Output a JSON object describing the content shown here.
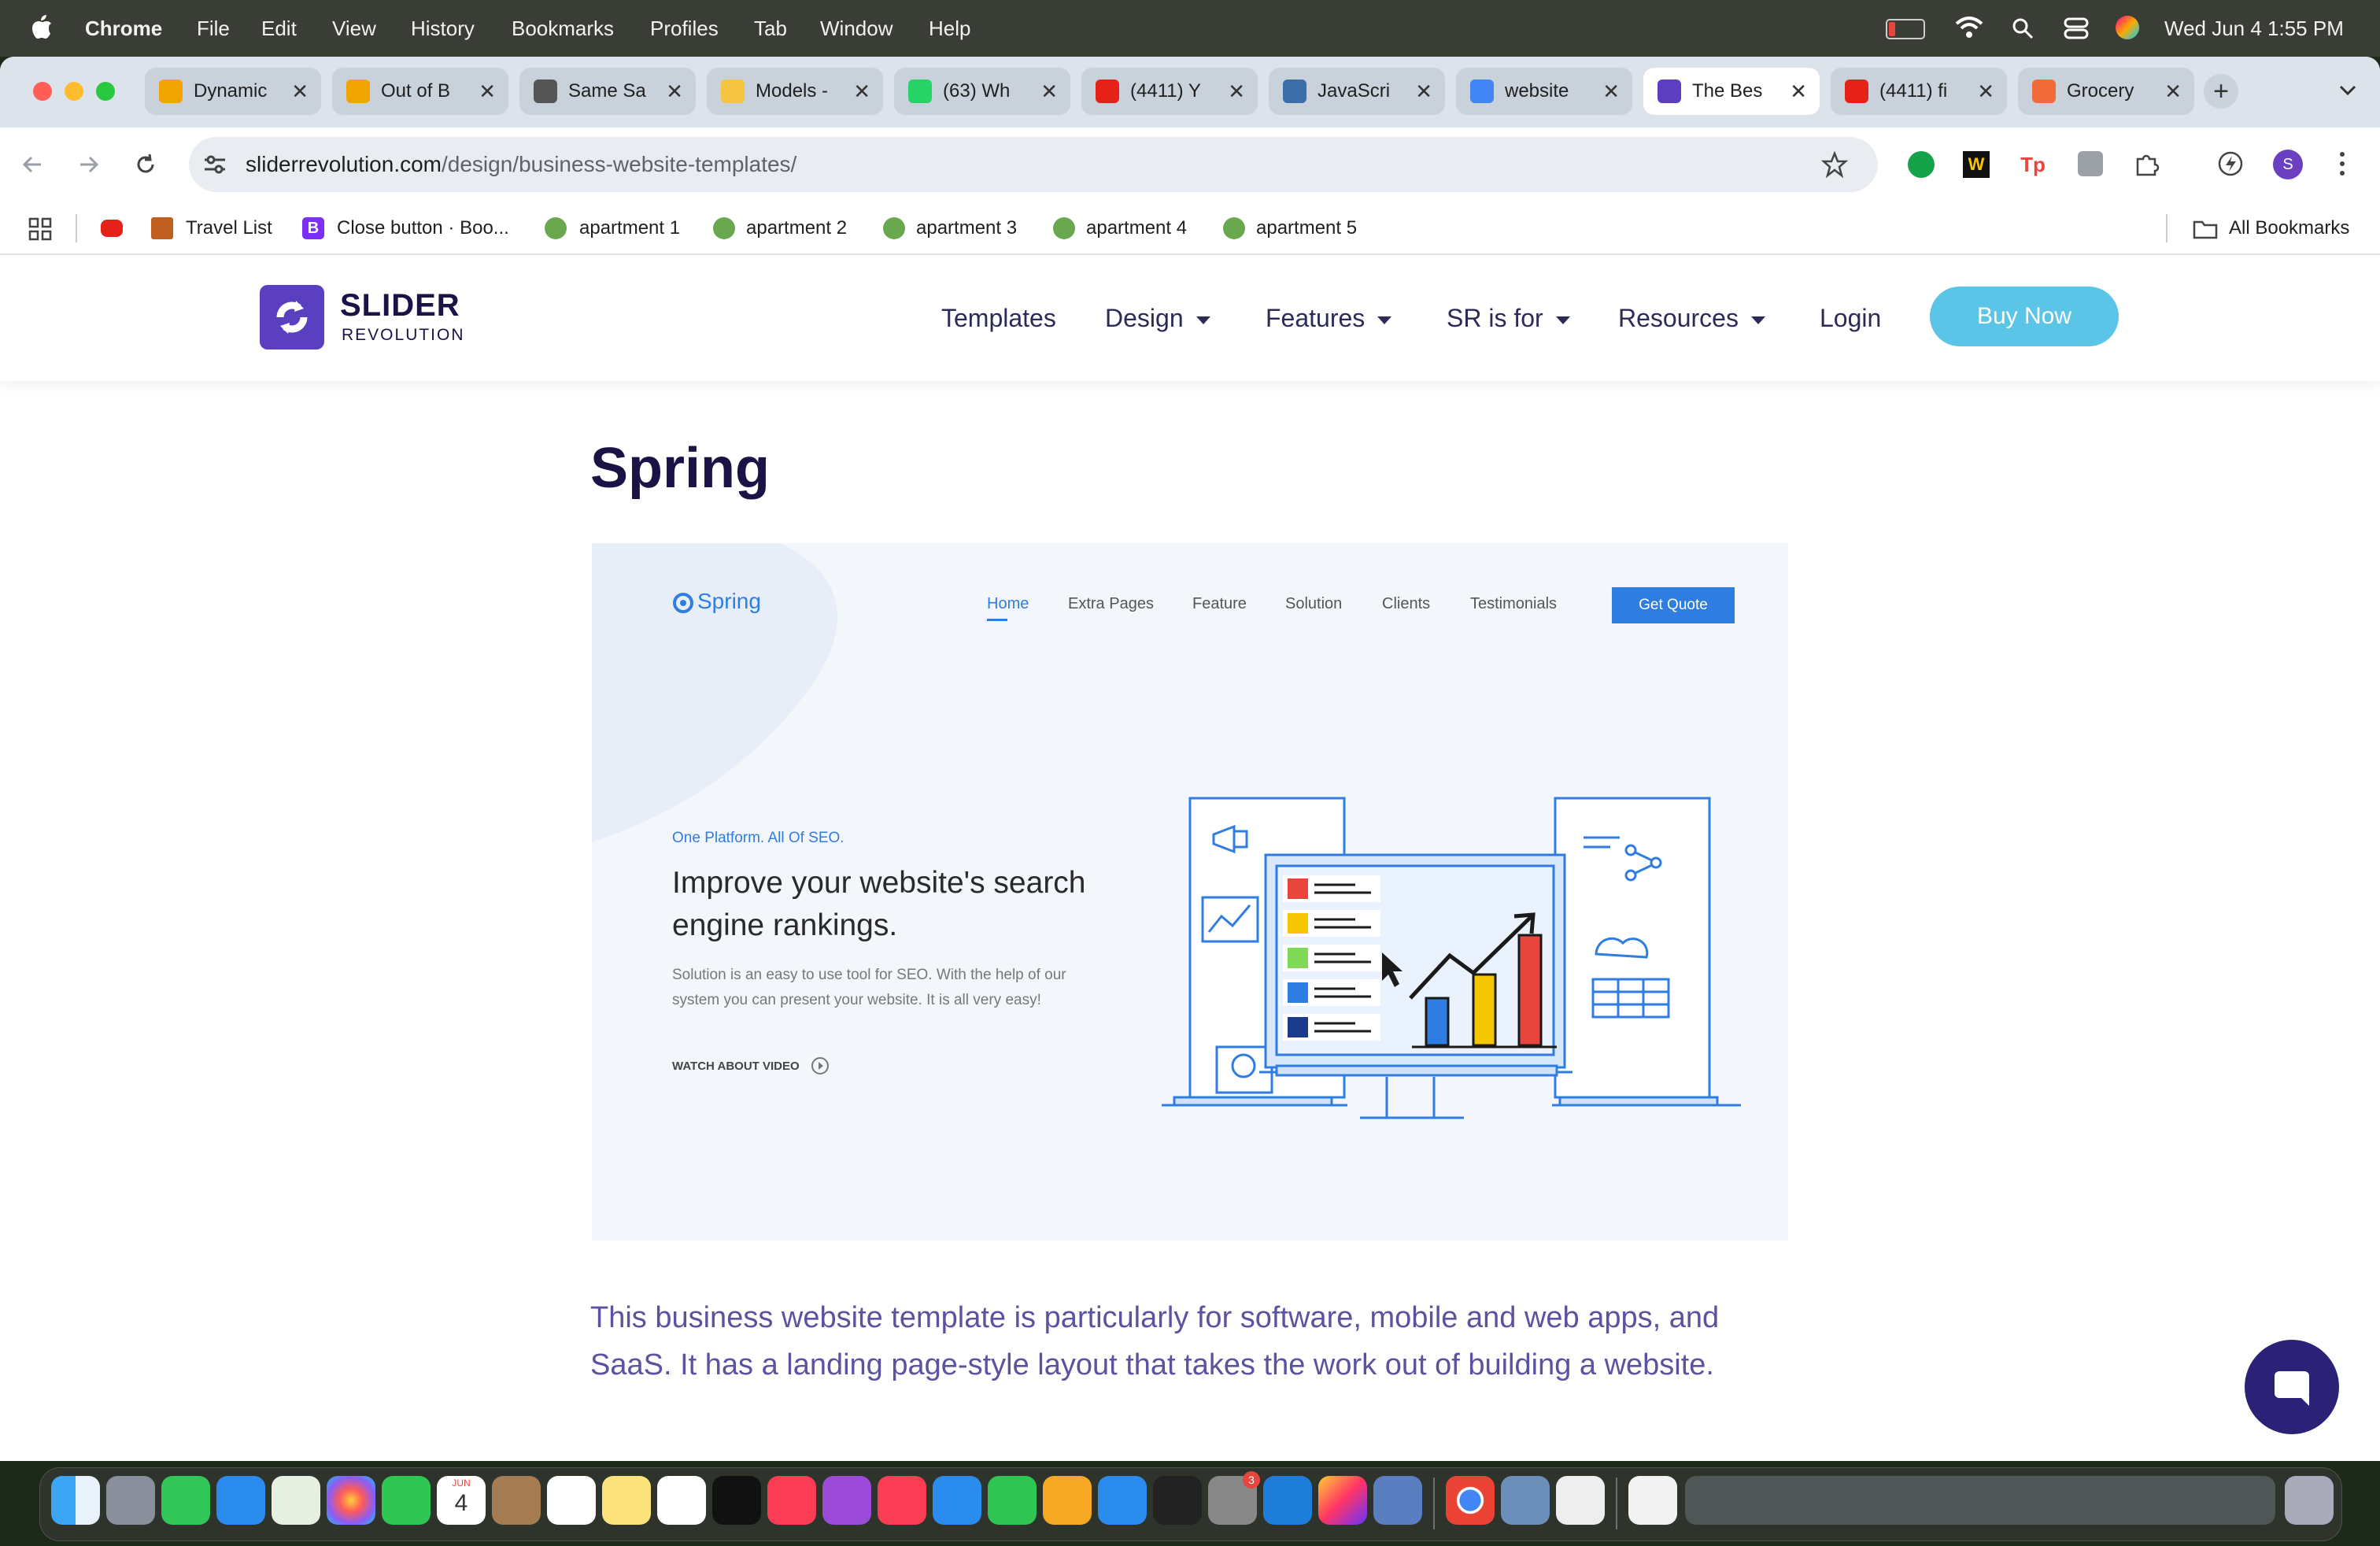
{
  "menubar": {
    "app": "Chrome",
    "items": [
      "File",
      "Edit",
      "View",
      "History",
      "Bookmarks",
      "Profiles",
      "Tab",
      "Window",
      "Help"
    ],
    "datetime": "Wed Jun 4  1:55 PM"
  },
  "tabs": [
    {
      "title": "Dynamic",
      "color": "#f0a500"
    },
    {
      "title": "Out of B",
      "color": "#f0a500"
    },
    {
      "title": "Same Sa",
      "color": "#555555"
    },
    {
      "title": "Models -",
      "color": "#f5c542"
    },
    {
      "title": "(63) Wh",
      "color": "#25d366"
    },
    {
      "title": "(4411) Y",
      "color": "#e62117"
    },
    {
      "title": "JavaScri",
      "color": "#3c6ea8"
    },
    {
      "title": "website",
      "color": "#4285f4"
    },
    {
      "title": "The Bes",
      "color": "#5a3fc0"
    },
    {
      "title": "(4411) fi",
      "color": "#e62117"
    },
    {
      "title": "Grocery",
      "color": "#f26b3a"
    }
  ],
  "address": {
    "domain": "sliderrevolution.com",
    "path": "/design/business-website-templates/"
  },
  "bookmarks": {
    "items": [
      "Travel List",
      "Close button · Boo...",
      "apartment 1",
      "apartment 2",
      "apartment 3",
      "apartment 4",
      "apartment 5"
    ],
    "all": "All Bookmarks"
  },
  "site": {
    "logo_main": "SLIDER",
    "logo_sub": "REVOLUTION",
    "nav": [
      "Templates",
      "Design",
      "Features",
      "SR is for",
      "Resources",
      "Login"
    ],
    "buy": "Buy Now",
    "page_title": "Spring",
    "description": "This business website template is particularly for software, mobile and web apps, and SaaS. It has a landing page-style layout that takes the work out of building a website."
  },
  "preview": {
    "logo": "Spring",
    "nav": [
      "Home",
      "Extra Pages",
      "Feature",
      "Solution",
      "Clients",
      "Testimonials"
    ],
    "cta": "Get Quote",
    "kicker": "One Platform. All Of SEO.",
    "headline_1": "Improve your website's search",
    "headline_2": "engine rankings.",
    "body_1": "Solution is an easy to use tool for SEO. With the help of our",
    "body_2": "system you can present your website. It is all very easy!",
    "video": "WATCH ABOUT VIDEO"
  },
  "dock": {
    "calendar_month": "JUN",
    "calendar_day": "4",
    "badge": "3"
  },
  "colors": {
    "brand": "#5a3fc0",
    "nav_text": "#2c2a57",
    "buy": "#5bc5e8",
    "desc": "#5b53a0",
    "preview_blue": "#2f7de1"
  }
}
